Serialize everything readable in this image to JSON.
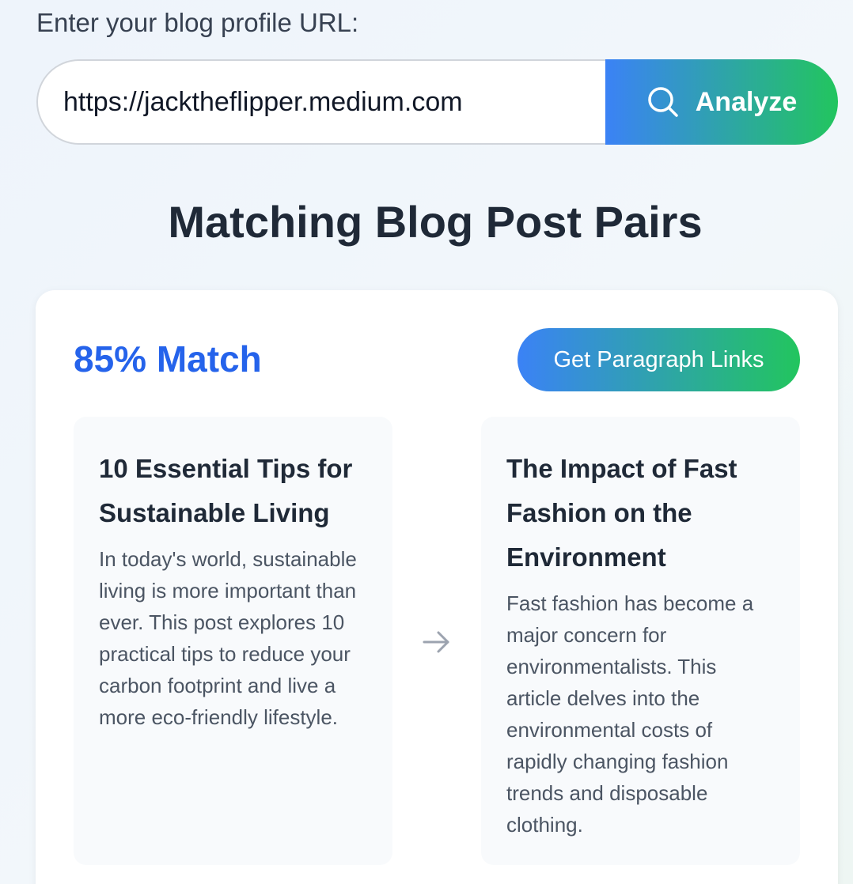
{
  "form": {
    "label": "Enter your blog profile URL:",
    "url_value": "https://jacktheflipper.medium.com",
    "analyze_label": "Analyze",
    "analyze_icon": "search-icon"
  },
  "results": {
    "heading": "Matching Blog Post Pairs",
    "pairs": [
      {
        "match_label": "85% Match",
        "links_button_label": "Get Paragraph Links",
        "arrow_icon": "arrow-right-icon",
        "source_post": {
          "title": "10 Essential Tips for Sustainable Living",
          "excerpt": "In today's world, sustainable living is more important than ever. This post explores 10 practical tips to reduce your carbon footprint and live a more eco-friendly lifestyle."
        },
        "target_post": {
          "title": "The Impact of Fast Fashion on the Environment",
          "excerpt": "Fast fashion has become a major concern for environmentalists. This article delves into the environmental costs of rapidly changing fashion trends and disposable clothing."
        }
      }
    ]
  },
  "colors": {
    "accent_blue": "#3b82f6",
    "accent_green": "#22c55e",
    "match_text": "#2563eb"
  }
}
